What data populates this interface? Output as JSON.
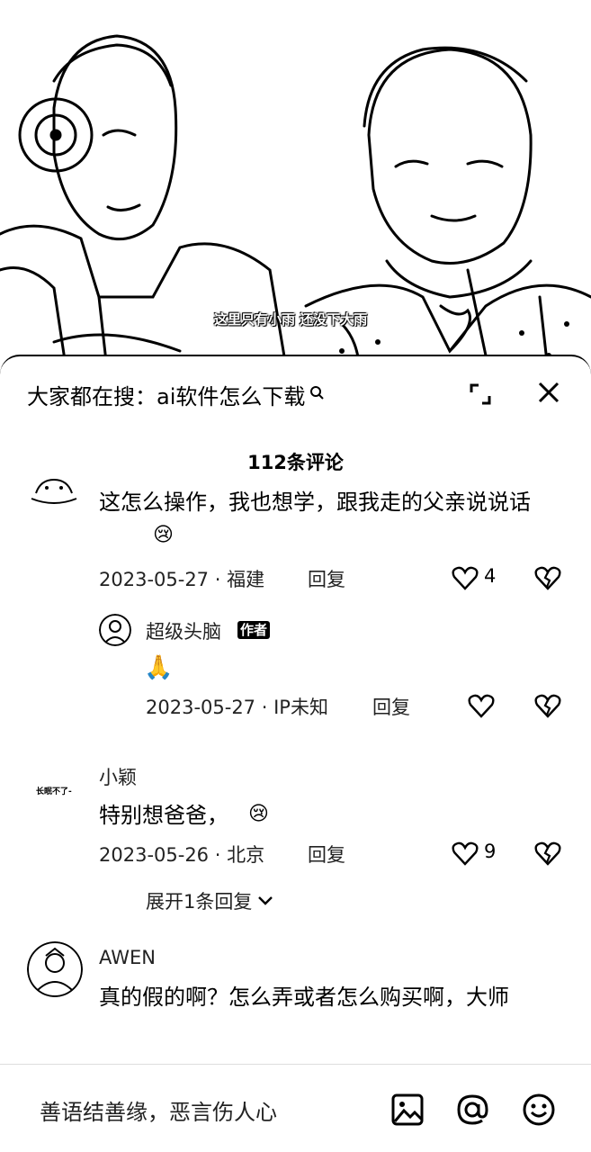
{
  "video": {
    "subtitle": "这里只有小雨 还没下大雨"
  },
  "search": {
    "label": "大家都在搜：",
    "query": "ai软件怎么下载"
  },
  "comments_header": {
    "count_label": "112条评论"
  },
  "comments": [
    {
      "text": "这怎么操作，我也想学，跟我走的父亲说说话",
      "date": "2023-05-27",
      "location": "福建",
      "reply_label": "回复",
      "likes": "4"
    },
    {
      "name": "超级头脑",
      "badge": "作者",
      "text": "🙏",
      "date": "2023-05-27",
      "location": "IP未知",
      "reply_label": "回复",
      "likes": ""
    },
    {
      "name": "小颖",
      "avatar_text": "长眠不了-",
      "text": "特别想爸爸，",
      "date": "2023-05-26",
      "location": "北京",
      "reply_label": "回复",
      "likes": "9",
      "expand_label": "展开1条回复"
    },
    {
      "name": "AWEN",
      "text": "真的假的啊？怎么弄或者怎么购买啊，大师"
    }
  ],
  "input_bar": {
    "placeholder": "善语结善缘，恶言伤人心"
  },
  "icons": {
    "expand": "expand-icon",
    "close": "close-icon",
    "like": "heart-icon",
    "dislike": "broken-heart-icon",
    "image": "image-icon",
    "mention": "at-icon",
    "emoji": "emoji-icon"
  }
}
